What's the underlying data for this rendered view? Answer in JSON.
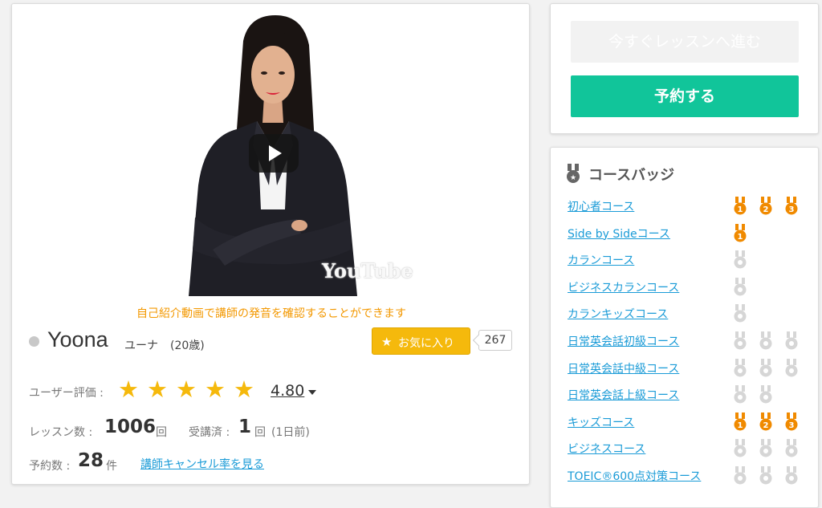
{
  "video": {
    "caption": "自己紹介動画で講師の発音を確認することができます",
    "watermark": "YouTube"
  },
  "teacher": {
    "name": "Yoona",
    "kana": "ユーナ",
    "age": "(20歳)",
    "status_color": "#c8c8c8"
  },
  "favorite": {
    "label": "お気に入り",
    "count": "267"
  },
  "rating": {
    "label": "ユーザー評価 :",
    "stars": 5,
    "value": "4.80"
  },
  "stats": {
    "lessons_label": "レッスン数 :",
    "lessons_value": "1006",
    "lessons_unit": "回",
    "taken_label": "受講済 :",
    "taken_value": "1",
    "taken_unit": "回",
    "taken_note": "(1日前)",
    "reservations_label": "予約数 :",
    "reservations_value": "28",
    "reservations_unit": "件",
    "cancel_link": "講師キャンセル率を見る"
  },
  "actions": {
    "start_lesson": "今すぐレッスンへ進む",
    "reserve": "予約する"
  },
  "badges": {
    "title": "コースバッジ",
    "courses": [
      {
        "name": "初心者コース",
        "medals": [
          "gold-1",
          "gold-2",
          "gold-3"
        ]
      },
      {
        "name": "Side by Sideコース",
        "medals": [
          "gold-1"
        ]
      },
      {
        "name": "カランコース",
        "medals": [
          "gray"
        ]
      },
      {
        "name": "ビジネスカランコース",
        "medals": [
          "gray"
        ]
      },
      {
        "name": "カランキッズコース",
        "medals": [
          "gray"
        ]
      },
      {
        "name": "日常英会話初級コース",
        "medals": [
          "gray",
          "gray",
          "gray"
        ]
      },
      {
        "name": "日常英会話中級コース",
        "medals": [
          "gray",
          "gray",
          "gray"
        ]
      },
      {
        "name": "日常英会話上級コース",
        "medals": [
          "gray",
          "gray"
        ]
      },
      {
        "name": "キッズコース",
        "medals": [
          "gold-1",
          "gold-2",
          "gold-3"
        ]
      },
      {
        "name": "ビジネスコース",
        "medals": [
          "gray",
          "gray",
          "gray"
        ]
      },
      {
        "name": "TOEIC®600点対策コース",
        "medals": [
          "gray",
          "gray",
          "gray"
        ]
      }
    ]
  },
  "colors": {
    "accent_green": "#11c59a",
    "favorite_yellow": "#f5b90c",
    "link_blue": "#1a9bd7",
    "caption_orange": "#f39800",
    "medal_gold": "#f08a00",
    "medal_gray": "#d6d6d6"
  }
}
